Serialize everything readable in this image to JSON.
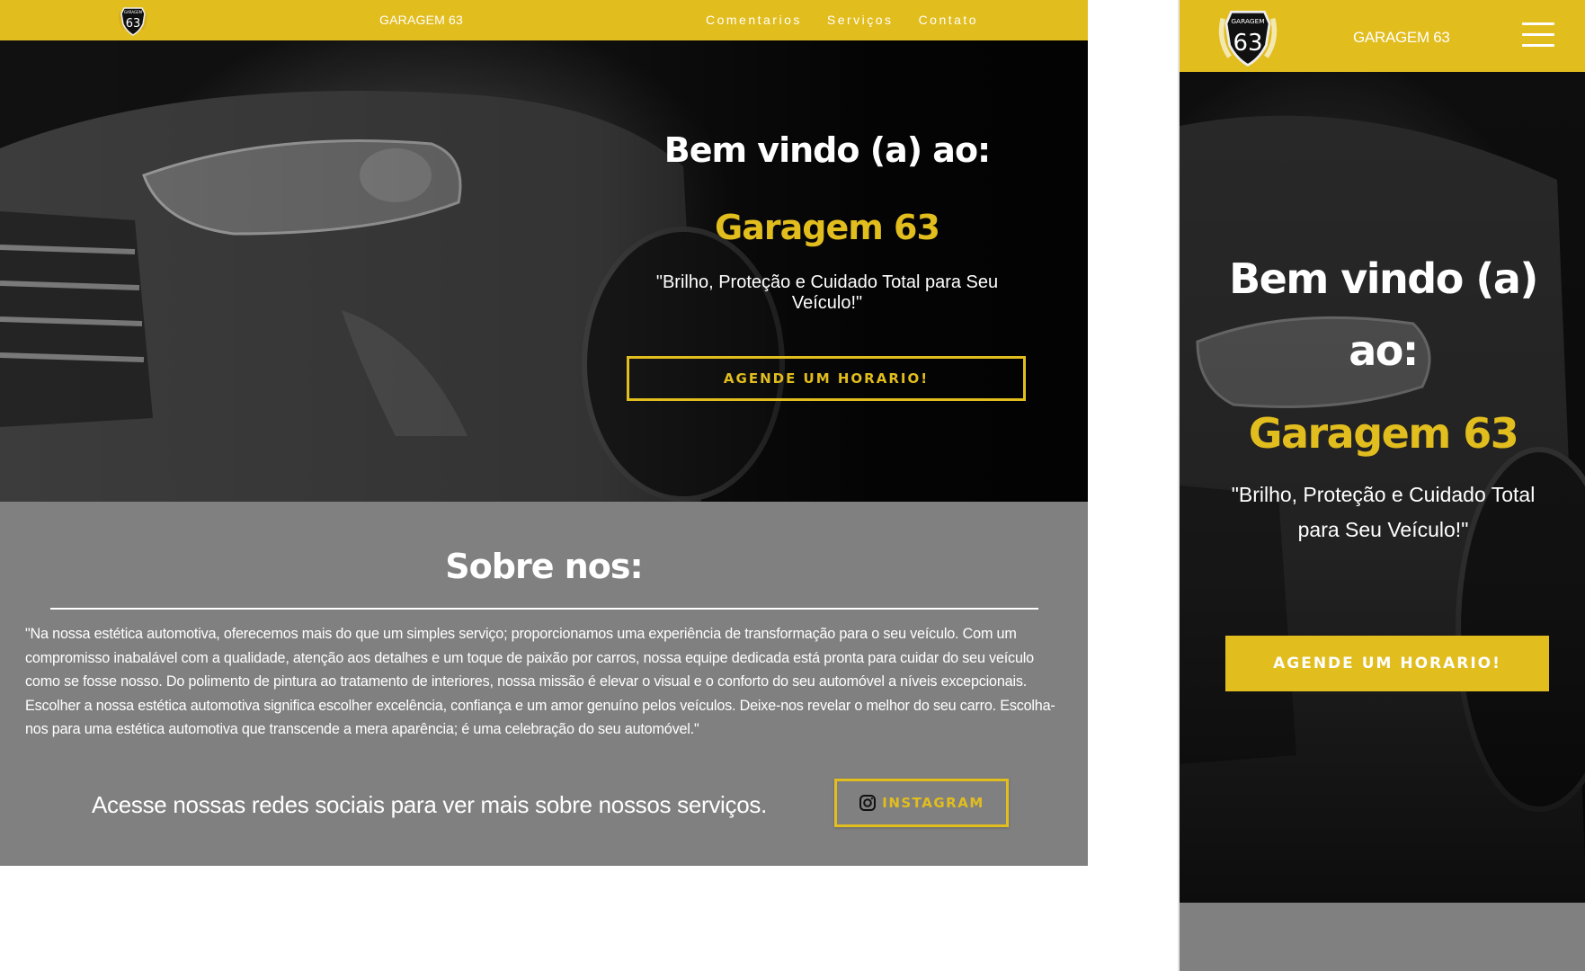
{
  "brand": {
    "name": "GARAGEM 63",
    "logo_top_text": "GARAGEM",
    "logo_number": "63"
  },
  "nav": {
    "items": [
      {
        "label": "Comentarios"
      },
      {
        "label": "Serviços"
      },
      {
        "label": "Contato"
      }
    ]
  },
  "hero": {
    "title_desktop": "Bem vindo (a) ao:",
    "title_mobile_line1": "Bem vindo (a)",
    "title_mobile_line2": "ao:",
    "name": "Garagem 63",
    "slogan": "\"Brilho, Proteção e Cuidado Total para Seu Veículo!\"",
    "cta_label": "AGENDE UM HORARIO!"
  },
  "about": {
    "title": "Sobre nos:",
    "text": "\"Na nossa estética automotiva, oferecemos mais do que um simples serviço; proporcionamos uma experiência de transformação para o seu veículo. Com um compromisso inabalável com a qualidade, atenção aos detalhes e um toque de paixão por carros, nossa equipe dedicada está pronta para cuidar do seu veículo como se fosse nosso. Do polimento de pintura ao tratamento de interiores, nossa missão é elevar o visual e o conforto do seu automóvel a níveis excepcionais. Escolher a nossa estética automotiva significa escolher excelência, confiança e um amor genuíno pelos veículos. Deixe-nos revelar o melhor do seu carro. Escolha-nos para uma estética automotiva que transcende a mera aparência; é uma celebração do seu automóvel.\"",
    "social_text": "Acesse nossas redes sociais para ver mais sobre nossos serviços.",
    "instagram_label": "INSTAGRAM"
  },
  "colors": {
    "accent": "#e2bd1e",
    "section_gray": "#808080",
    "text_light": "#ffffff"
  },
  "icons": [
    "logo-badge-icon",
    "instagram-icon",
    "hamburger-menu-icon"
  ]
}
